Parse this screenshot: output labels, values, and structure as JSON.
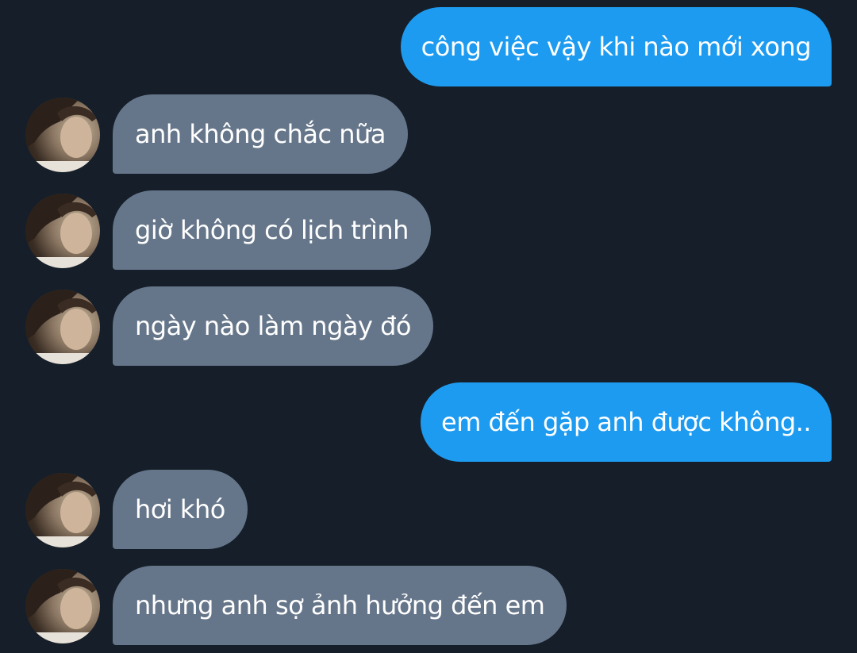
{
  "conversation": {
    "messages": [
      {
        "sender": "me",
        "text": "công việc vậy khi nào mới xong"
      },
      {
        "sender": "other",
        "text": "anh không chắc nữa"
      },
      {
        "sender": "other",
        "text": "giờ không có lịch trình"
      },
      {
        "sender": "other",
        "text": "ngày nào làm ngày đó"
      },
      {
        "sender": "me",
        "text": "em đến gặp anh được không.."
      },
      {
        "sender": "other",
        "text": "hơi khó"
      },
      {
        "sender": "other",
        "text": "nhưng anh sợ ảnh hưởng đến em"
      }
    ]
  },
  "colors": {
    "background": "#151e29",
    "sent_bubble": "#1d9bf0",
    "received_bubble": "#66768a",
    "text": "#ffffff"
  },
  "icons": {
    "avatar": "contact-avatar-photo"
  }
}
